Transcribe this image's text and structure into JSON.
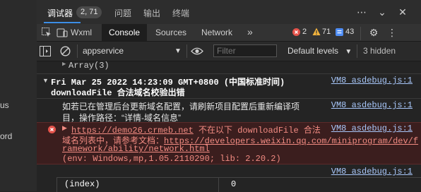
{
  "left_panel": {
    "frag1": "us",
    "frag2": "ord"
  },
  "top_tabs": {
    "debug": "调试器",
    "badge": "2, 71",
    "issues": "问题",
    "output": "输出",
    "terminal": "终端"
  },
  "toolbar2": {
    "wxml": "Wxml",
    "console": "Console",
    "sources": "Sources",
    "network": "Network",
    "more": "»",
    "errors": "2",
    "warnings": "71",
    "infos": "43"
  },
  "toolbar3": {
    "context": "appservice",
    "filter_placeholder": "Filter",
    "levels": "Default levels",
    "hidden": "3 hidden"
  },
  "console": {
    "array_row": "Array(3)",
    "group_line1": "Fri Mar 25 2022 14:23:09 GMT+0800 (中国标准时间)",
    "group_line2": "downloadFile 合法域名校验出错",
    "group_src": "VM8 asdebug.js:1",
    "info_line1": "如若已在管理后台更新域名配置，请刷新项目配置后重新编译项",
    "info_line2": "目，操作路径：“详情-域名信息”",
    "info_src": "VM8 asdebug.js:1",
    "err_url": "https://demo26.crmeb.net",
    "err_text1": " 不在以下 downloadFile 合法",
    "err_text2": "域名列表中，请参考文档：",
    "err_doc1": "https://developers.weixin.qq.com/miniprogram/dev/f",
    "err_doc2": "ramework/ability/network.html",
    "err_env": "(env: Windows,mp,1.05.2110290; lib: 2.20.2)",
    "err_src": "VM8 asdebug.js:1",
    "last_src": "VM8 asdebug.js:1",
    "table_col1": "(index)",
    "table_col2": "0"
  },
  "colors": {
    "accent": "#3c8ee6",
    "error": "#f28b82",
    "link": "#a8c7fa"
  }
}
